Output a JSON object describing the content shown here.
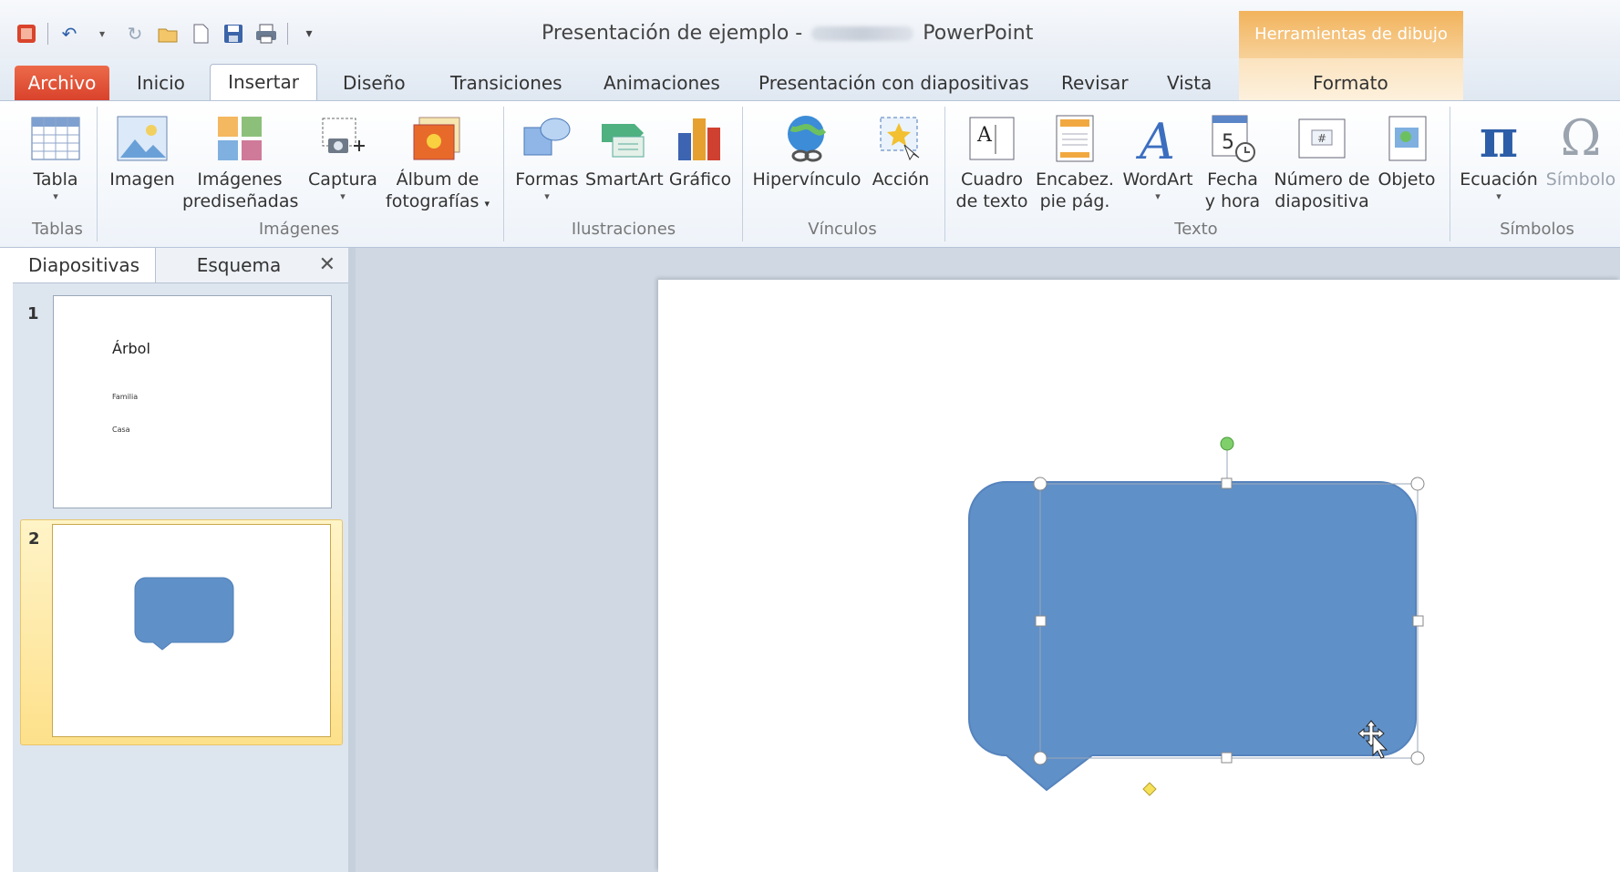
{
  "window": {
    "title_left": "Presentación de ejemplo -",
    "title_right": "PowerPoint",
    "contextual_band": "Herramientas de dibujo"
  },
  "quick_access": [
    "app-icon",
    "undo-icon",
    "dropdown-icon",
    "redo-icon",
    "open-icon",
    "new-icon",
    "save-icon",
    "print-icon",
    "customize-icon"
  ],
  "tabs": {
    "file": "Archivo",
    "inicio": "Inicio",
    "insertar": "Insertar",
    "diseno": "Diseño",
    "transiciones": "Transiciones",
    "animaciones": "Animaciones",
    "presentacion": "Presentación con diapositivas",
    "revisar": "Revisar",
    "vista": "Vista",
    "formato": "Formato"
  },
  "ribbon": {
    "tabla": "Tabla",
    "imagen": "Imagen",
    "imagenes_1": "Imágenes",
    "imagenes_2": "prediseñadas",
    "captura": "Captura",
    "album_1": "Álbum de",
    "album_2": "fotografías",
    "formas": "Formas",
    "smartart": "SmartArt",
    "grafico": "Gráfico",
    "hipervinculo": "Hipervínculo",
    "accion": "Acción",
    "cuadro_1": "Cuadro",
    "cuadro_2": "de texto",
    "encabez_1": "Encabez.",
    "encabez_2": "pie pág.",
    "wordart": "WordArt",
    "fecha_1": "Fecha",
    "fecha_2": "y hora",
    "numero_1": "Número de",
    "numero_2": "diapositiva",
    "objeto": "Objeto",
    "ecuacion": "Ecuación",
    "simbolo": "Símbolo",
    "groups": {
      "tablas": "Tablas",
      "imagenes": "Imágenes",
      "ilustraciones": "Ilustraciones",
      "vinculos": "Vínculos",
      "texto": "Texto",
      "simbolos": "Símbolos"
    }
  },
  "panel": {
    "tab_diapositivas": "Diapositivas",
    "tab_esquema": "Esquema",
    "close": "✕",
    "slide1": {
      "num": "1",
      "title": "Árbol",
      "line1": "Familia",
      "line2": "Casa"
    },
    "slide2": {
      "num": "2"
    }
  },
  "colors": {
    "shape_fill": "#6090c8",
    "file_tab": "#d9442b",
    "contextual": "#f2b35c"
  }
}
